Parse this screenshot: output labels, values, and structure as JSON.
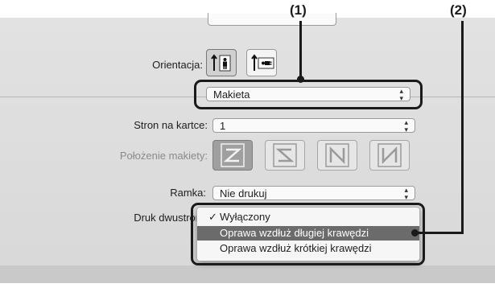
{
  "callouts": {
    "one": "(1)",
    "two": "(2)"
  },
  "orientation": {
    "label": "Orientacja:"
  },
  "section_menu": {
    "value": "Makieta"
  },
  "pages_per_sheet": {
    "label": "Stron na kartce:",
    "value": "1"
  },
  "layout_direction": {
    "label": "Położenie makiety:"
  },
  "border": {
    "label": "Ramka:",
    "value": "Nie drukuj"
  },
  "two_sided": {
    "label": "Druk dwustron",
    "options": [
      {
        "label": "Wyłączony",
        "checked": true
      },
      {
        "label": "Oprawa wzdłuż długiej krawędzi",
        "highlighted": true
      },
      {
        "label": "Oprawa wzdłuż krótkiej krawędzi"
      }
    ]
  },
  "colors": {
    "callout": "#1a1a1a",
    "menu_highlight": "#6b6b6b",
    "panel": "#dedede"
  }
}
